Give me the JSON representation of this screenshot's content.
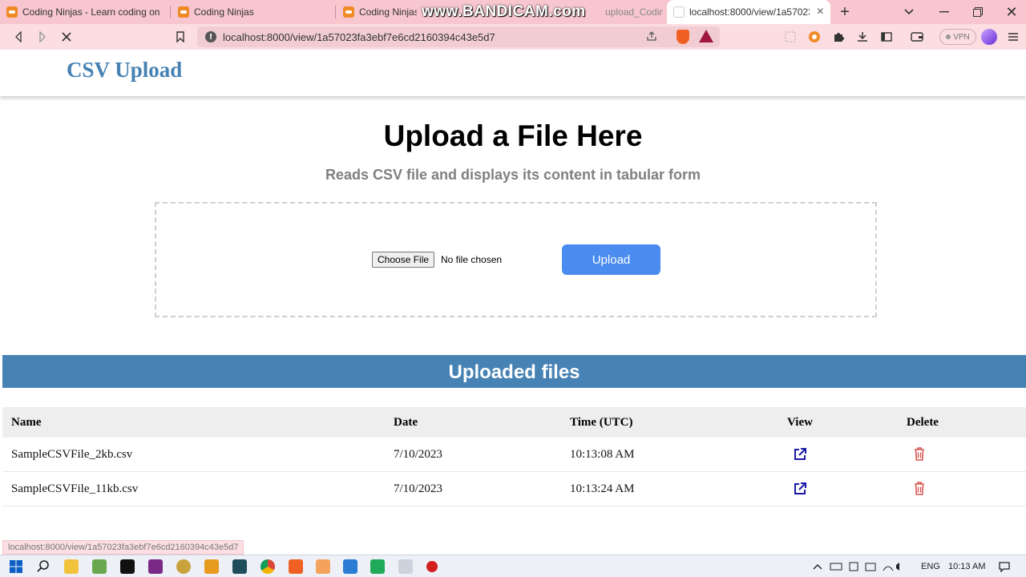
{
  "browser": {
    "tabs": [
      {
        "title": "Coding Ninjas - Learn coding online"
      },
      {
        "title": "Coding Ninjas"
      },
      {
        "title": "Coding Ninjas"
      },
      {
        "title": "upload_Coding"
      },
      {
        "title": "localhost:8000/view/1a57023"
      }
    ],
    "watermark": "www.BANDICAM.com",
    "url": "localhost:8000/view/1a57023fa3ebf7e6cd2160394c43e5d7",
    "vpn_label": "VPN",
    "status_url": "localhost:8000/view/1a57023fa3ebf7e6cd2160394c43e5d7"
  },
  "site": {
    "logo": "CSV Upload",
    "heading": "Upload a File Here",
    "subheading": "Reads CSV file and displays its content in tabular form",
    "file_input": {
      "button_label": "Choose File",
      "status": "No file chosen"
    },
    "upload_label": "Upload",
    "section_title": "Uploaded files"
  },
  "files_table": {
    "headers": {
      "name": "Name",
      "date": "Date",
      "time": "Time (UTC)",
      "view": "View",
      "delete": "Delete"
    },
    "rows": [
      {
        "name": "SampleCSVFile_2kb.csv",
        "date": "7/10/2023",
        "time": "10:13:08 AM"
      },
      {
        "name": "SampleCSVFile_11kb.csv",
        "date": "7/10/2023",
        "time": "10:13:24 AM"
      }
    ]
  },
  "taskbar": {
    "lang": "ENG",
    "clock": "10:13 AM"
  },
  "colors": {
    "brand": "#4682b4",
    "upload_button": "#4a8cf0",
    "delete_icon": "#d9534f",
    "view_icon": "#1a1aa6",
    "tab_bar": "#f7c6ce"
  }
}
